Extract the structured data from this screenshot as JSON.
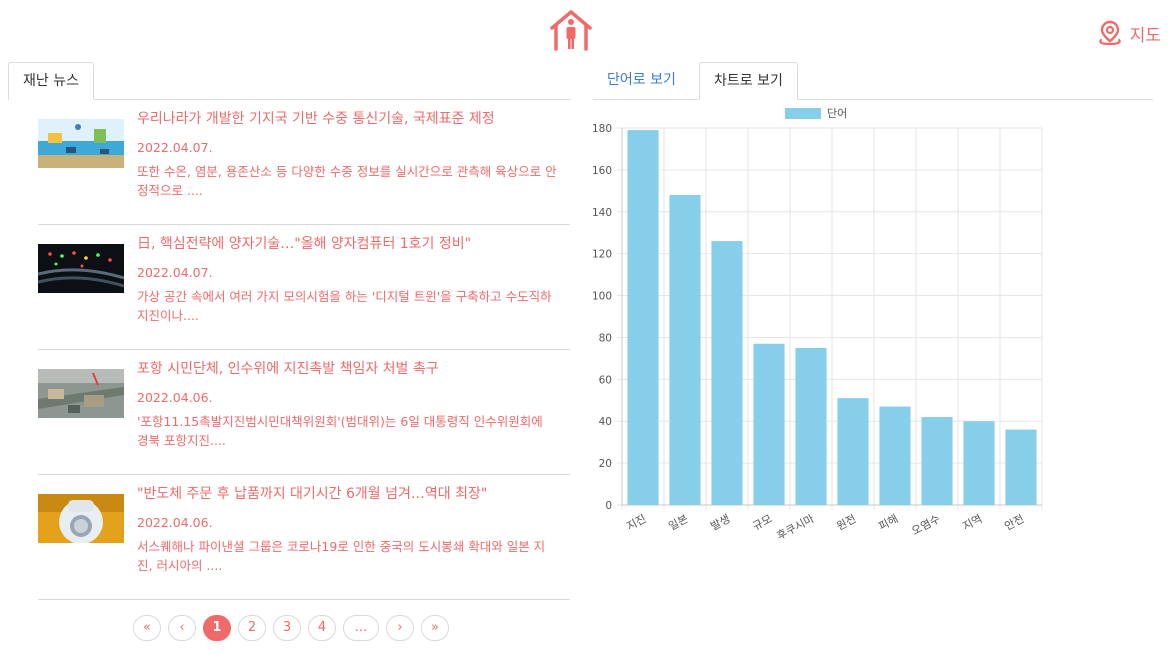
{
  "header": {
    "map_label": "지도"
  },
  "left_tabs": [
    {
      "label": "재난 뉴스"
    }
  ],
  "right_tabs": [
    {
      "label": "단어로 보기"
    },
    {
      "label": "차트로 보기"
    }
  ],
  "news": [
    {
      "title": "우리나라가 개발한 기지국 기반 수중 통신기술, 국제표준 제정",
      "date": "2022.04.07.",
      "summary": "또한 수온, 염분, 용존산소 등 다양한 수중 정보를 실시간으로 관측해 육상으로 안정적으로 ...."
    },
    {
      "title": "日, 핵심전략에 양자기술…\"올해 양자컴퓨터 1호기 정비\"",
      "date": "2022.04.07.",
      "summary": "가상 공간 속에서 여러 가지 모의시험을 하는 '디지털 트윈'을 구축하고 수도직하 지진이나...."
    },
    {
      "title": "포항 시민단체, 인수위에 지진촉발 책임자 처벌 촉구",
      "date": "2022.04.06.",
      "summary": "'포항11.15촉발지진범시민대책위원회'(범대위)는 6일 대통령직 인수위원회에 경북 포항지진...."
    },
    {
      "title": "\"반도체 주문 후 납품까지 대기시간 6개월 넘겨…역대 최장\"",
      "date": "2022.04.06.",
      "summary": "서스퀘해나 파이낸셜 그룹은 코로나19로 인한 중국의 도시봉쇄 확대와 일본 지진, 러시아의 ...."
    }
  ],
  "pagination": {
    "first": "«",
    "prev": "‹",
    "pages": [
      "1",
      "2",
      "3",
      "4"
    ],
    "ellipsis": "...",
    "next": "›",
    "last": "»"
  },
  "chart_data": {
    "type": "bar",
    "categories": [
      "지진",
      "일본",
      "발생",
      "규모",
      "후쿠시마",
      "원전",
      "피해",
      "오염수",
      "지역",
      "안전"
    ],
    "series": [
      {
        "name": "단어",
        "values": [
          179,
          148,
          126,
          77,
          75,
          51,
          47,
          42,
          40,
          36
        ]
      }
    ],
    "ylim": [
      0,
      180
    ],
    "yticks": [
      0,
      20,
      40,
      60,
      80,
      100,
      120,
      140,
      160,
      180
    ],
    "color": "#87ceeb",
    "grid": true,
    "legend": "top"
  },
  "colors": {
    "accent": "#f06a6a",
    "link": "#3b7bd4",
    "bar": "#87ceeb"
  }
}
